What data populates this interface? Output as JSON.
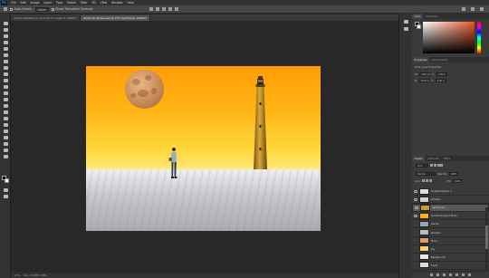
{
  "app": {
    "logo": "Ps"
  },
  "menu": [
    "File",
    "Edit",
    "Image",
    "Layer",
    "Type",
    "Select",
    "Filter",
    "3D",
    "View",
    "Window",
    "Help"
  ],
  "options_bar": {
    "auto_select_label": "Auto-Select:",
    "auto_select_value": "Layer",
    "show_transform_label": "Show Transform Controls"
  },
  "tabs": [
    {
      "label": "closed-opposite-you-fjr-b-16.7% (Layer 0, RGB/8)*"
    },
    {
      "label": "winter-landscape.psd @ 17% (lighthouse, RGB/8)*"
    }
  ],
  "canvas": {
    "scene": "winter landscape with moon, lighthouse and walking person",
    "colors": {
      "sky_top": "#ff9d0a",
      "sky_bottom": "#ffe878",
      "snow": "#d9dade",
      "moon": "#d9a06b",
      "lighthouse": "#c89a2a"
    }
  },
  "status": {
    "zoom": "17%",
    "doc": "Doc: 24.9M/1.36G"
  },
  "color_panel": {
    "tabs": [
      "Color",
      "Swatches"
    ]
  },
  "properties_panel": {
    "tabs": [
      "Properties",
      "Adjustments"
    ],
    "title": "Pixel Layer Properties",
    "w_label": "W:",
    "w_value": "1955 px",
    "h_label": "H:",
    "h_value": "3016 px",
    "x_label": "X:",
    "x_value": "4.06 in",
    "y_label": "Y:",
    "y_value": "0.40 in"
  },
  "layers_panel": {
    "tabs": [
      "Layers",
      "Channels",
      "Paths"
    ],
    "kind_label": "Kind",
    "blend_mode": "Normal",
    "opacity_label": "Opacity:",
    "opacity_value": "100%",
    "lock_label": "Lock:",
    "fill_label": "Fill:",
    "fill_value": "100%",
    "layers": [
      {
        "name": "Hue/Saturation 1",
        "visible": true,
        "selected": false,
        "thumb": "#dddddd"
      },
      {
        "name": "shadow",
        "visible": true,
        "selected": false,
        "thumb": "#cfcfcf"
      },
      {
        "name": "lighthouse",
        "visible": true,
        "selected": true,
        "thumb": "#c89a2a"
      },
      {
        "name": "Gradient layout Moon",
        "visible": true,
        "selected": false,
        "thumb": "#ffb213"
      },
      {
        "name": "person",
        "visible": false,
        "selected": false,
        "thumb": "#9aa6b2"
      },
      {
        "name": "shadow",
        "visible": false,
        "selected": false,
        "thumb": "#bdbdbd"
      },
      {
        "name": "Moon",
        "visible": false,
        "selected": false,
        "thumb": "#d9a06b"
      },
      {
        "name": "sky",
        "visible": false,
        "selected": false,
        "thumb": "#ffcc66"
      },
      {
        "name": "Background",
        "visible": false,
        "selected": false,
        "thumb": "#e6e6ea"
      },
      {
        "name": "Snow",
        "visible": false,
        "selected": false,
        "thumb": "#d9dade"
      }
    ]
  }
}
